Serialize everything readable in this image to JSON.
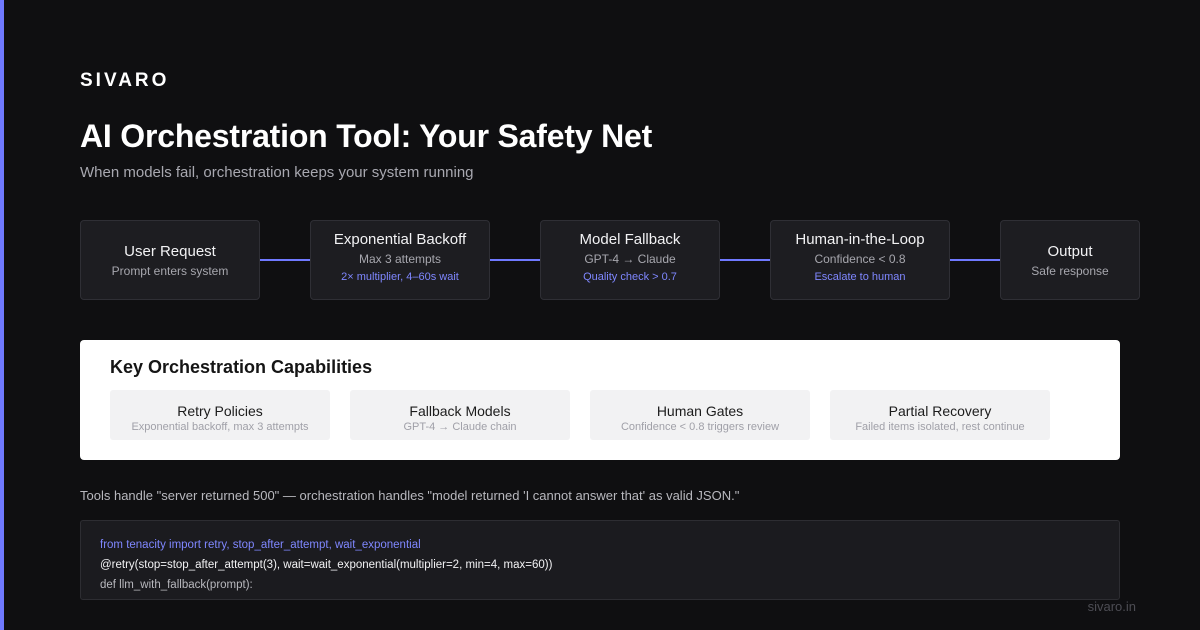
{
  "brand": "SIVARO",
  "title": "AI Orchestration Tool: Your Safety Net",
  "subtitle": "When models fail, orchestration keeps your system running",
  "flow": {
    "nodes": [
      {
        "title": "User Request",
        "subtitle": "Prompt enters system",
        "note": ""
      },
      {
        "title": "Exponential Backoff",
        "subtitle": "Max 3 attempts",
        "note": "2× multiplier, 4–60s wait"
      },
      {
        "title": "Model Fallback",
        "subtitle": "GPT-4 → Claude",
        "note": "Quality check > 0.7"
      },
      {
        "title": "Human-in-the-Loop",
        "subtitle": "Confidence < 0.8",
        "note": "Escalate to human"
      },
      {
        "title": "Output",
        "subtitle": "Safe response",
        "note": ""
      }
    ]
  },
  "capabilities": {
    "title": "Key Orchestration Capabilities",
    "items": [
      {
        "title": "Retry Policies",
        "description": "Exponential backoff, max 3 attempts"
      },
      {
        "title": "Fallback Models",
        "description": "GPT-4 → Claude chain"
      },
      {
        "title": "Human Gates",
        "description": "Confidence < 0.8 triggers review"
      },
      {
        "title": "Partial Recovery",
        "description": "Failed items isolated, rest continue"
      }
    ]
  },
  "quote": "Tools handle \"server returned 500\" — orchestration handles \"model returned 'I cannot answer that' as valid JSON.\"",
  "code": {
    "line1": "from tenacity import retry, stop_after_attempt, wait_exponential",
    "line2": "@retry(stop=stop_after_attempt(3), wait=wait_exponential(multiplier=2, min=4, max=60))",
    "line3": "def llm_with_fallback(prompt):"
  },
  "footer": {
    "domain": "sivaro.in"
  },
  "colors": {
    "background": "#0f0f11",
    "accent": "#6f79ff",
    "panel": "#ffffff",
    "node": "#1d1d21"
  }
}
